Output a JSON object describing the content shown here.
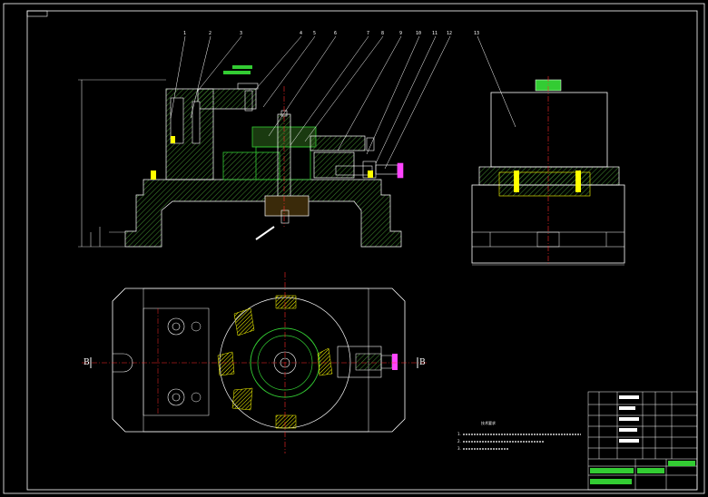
{
  "drawing": {
    "section_label_left": "B",
    "section_label_right": "B",
    "part_numbers": [
      "1",
      "2",
      "3",
      "4",
      "5",
      "6",
      "7",
      "8",
      "9",
      "10",
      "11",
      "12",
      "13"
    ],
    "notes_title": "技术要求",
    "notes": [
      "1.",
      "2.",
      "3."
    ]
  },
  "colors": {
    "background": "#000000",
    "white": "#ffffff",
    "green": "#33cc33",
    "lime": "#99ff33",
    "yellow": "#ffff00",
    "red": "#ff2a2a",
    "cyan": "#33ffff",
    "magenta": "#ff44ff"
  }
}
